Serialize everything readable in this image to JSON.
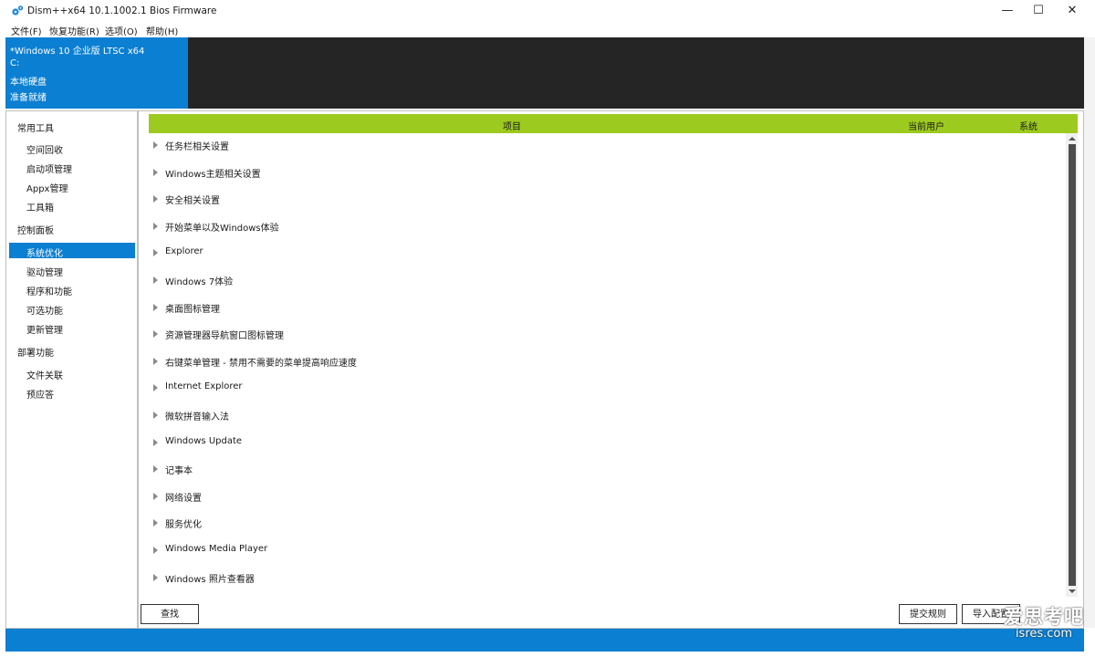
{
  "window": {
    "title": "Dism++x64 10.1.1002.1 Bios Firmware",
    "icon": "gears-icon",
    "controls": {
      "minimize": "—",
      "maximize": "☐",
      "close": "✕"
    }
  },
  "menu": [
    "文件(F)",
    "恢复功能(R)",
    "选项(O)",
    "帮助(H)"
  ],
  "system_info": {
    "os": "*Windows 10 企业版 LTSC x64",
    "drive": "C:",
    "disk": "本地硬盘",
    "status": "准备就绪"
  },
  "sidebar": {
    "groups": [
      {
        "title": "常用工具",
        "items": [
          "空间回收",
          "启动项管理",
          "Appx管理",
          "工具箱"
        ]
      },
      {
        "title": "控制面板",
        "items": [
          "系统优化",
          "驱动管理",
          "程序和功能",
          "可选功能",
          "更新管理"
        ]
      },
      {
        "title": "部署功能",
        "items": [
          "文件关联",
          "预应答"
        ]
      }
    ],
    "selected": "系统优化"
  },
  "table": {
    "headers": {
      "item": "项目",
      "current_user": "当前用户",
      "system": "系统"
    },
    "rows": [
      "任务栏相关设置",
      "Windows主题相关设置",
      "安全相关设置",
      "开始菜单以及Windows体验",
      "Explorer",
      "Windows 7体验",
      "桌面图标管理",
      "资源管理器导航窗口图标管理",
      "右键菜单管理 - 禁用不需要的菜单提高响应速度",
      "Internet Explorer",
      "微软拼音输入法",
      "Windows Update",
      "记事本",
      "网络设置",
      "服务优化",
      "Windows Media Player",
      "Windows 照片查看器"
    ]
  },
  "buttons": {
    "find": "查找",
    "submit_rules": "提交规则",
    "import_config": "导入配置"
  },
  "watermark": {
    "cn": "爱思考吧",
    "domain": "isres.com"
  },
  "colors": {
    "accent_blue": "#0b7fd1",
    "header_green": "#9dca1f",
    "banner_dark": "#252525"
  }
}
